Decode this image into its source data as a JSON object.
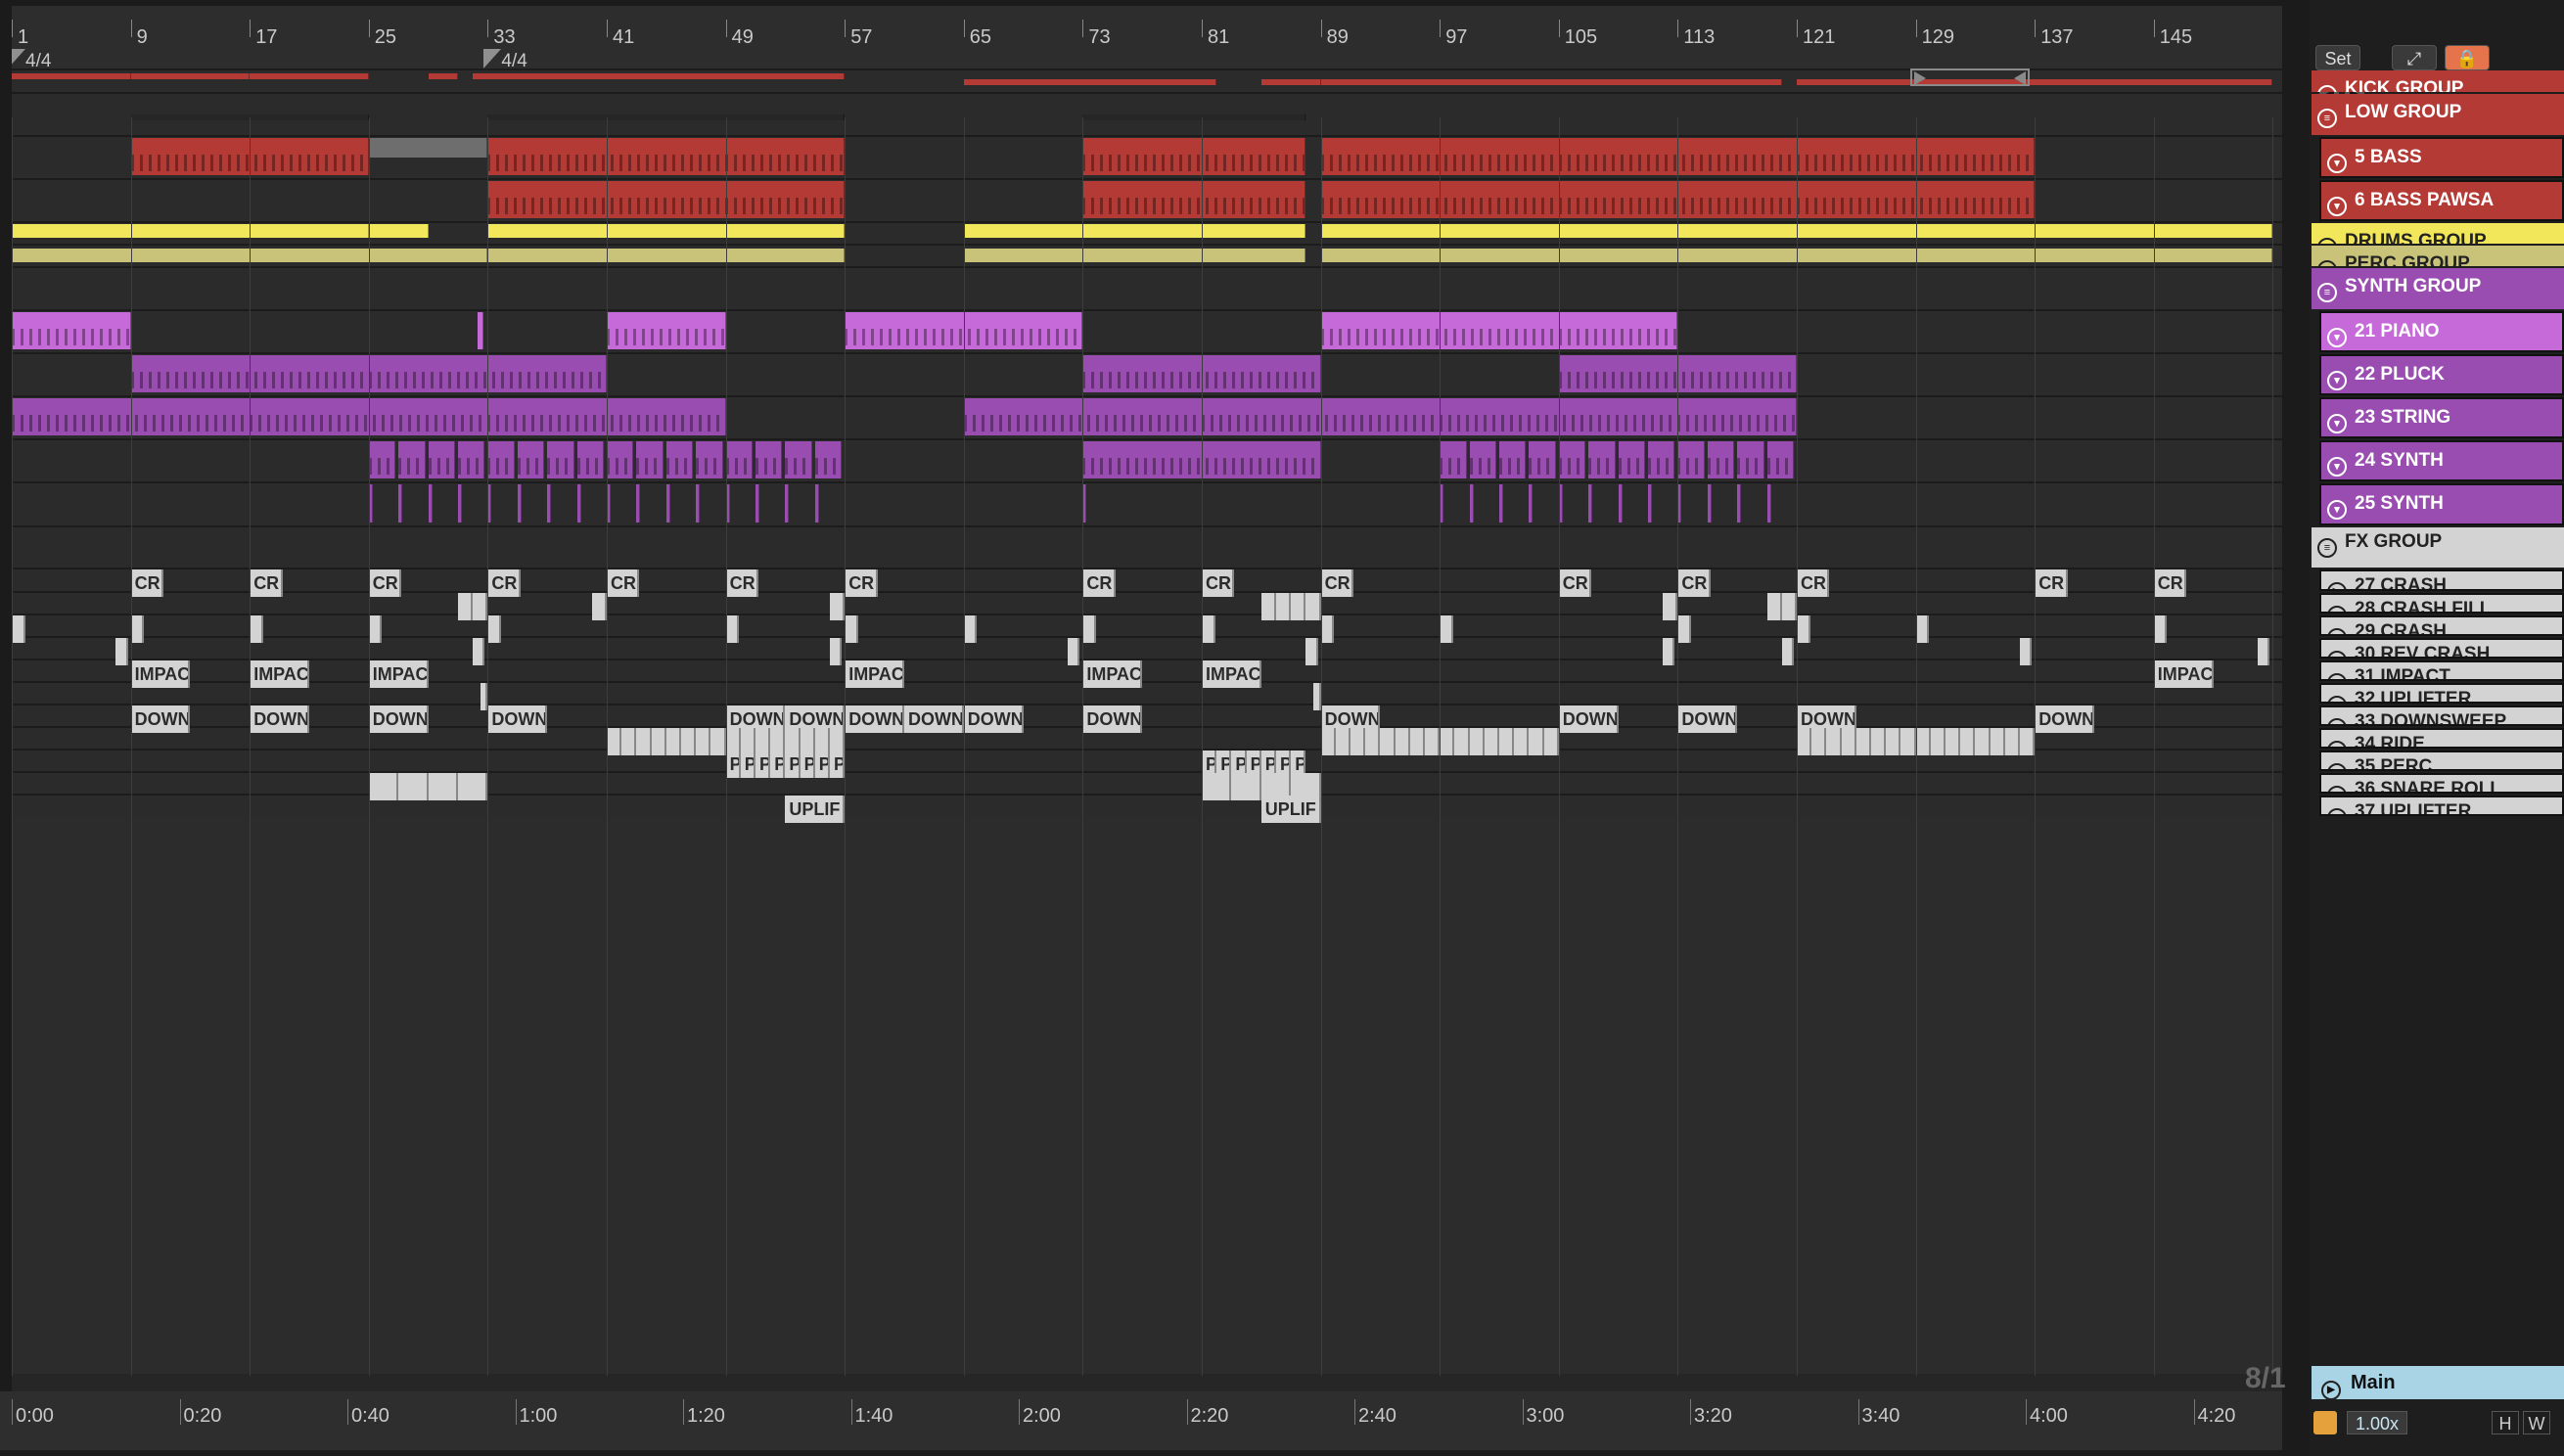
{
  "ruler": {
    "bars": [
      "1",
      "9",
      "17",
      "25",
      "33",
      "41",
      "49",
      "57",
      "65",
      "73",
      "81",
      "89",
      "97",
      "105",
      "113",
      "121",
      "129",
      "137",
      "145"
    ],
    "time_signatures": [
      "4/4",
      "4/4"
    ]
  },
  "controls": {
    "set_label": "Set",
    "expand_icon": "expand-icon",
    "lock_icon": "lock-icon",
    "nav_left": "arrow-left-icon",
    "nav_right": "arrow-right-icon"
  },
  "colors": {
    "red": "#b43a35",
    "yellow": "#f2e65b",
    "olive": "#c9c37a",
    "purple": "#9a4db0",
    "pink": "#c56ad8",
    "fx": "#d3d3d3",
    "main": "#a9d4e6"
  },
  "tracks": [
    {
      "name": "KICK GROUP",
      "type": "group"
    },
    {
      "name": "LOW GROUP",
      "type": "group"
    },
    {
      "name": "5 BASS",
      "type": "midi"
    },
    {
      "name": "6 BASS PAWSA",
      "type": "midi"
    },
    {
      "name": "DRUMS GROUP",
      "type": "group"
    },
    {
      "name": "PERC GROUP",
      "type": "group"
    },
    {
      "name": "SYNTH GROUP",
      "type": "group"
    },
    {
      "name": "21 PIANO",
      "type": "midi"
    },
    {
      "name": "22 PLUCK",
      "type": "midi"
    },
    {
      "name": "23 STRING",
      "type": "midi"
    },
    {
      "name": "24 SYNTH",
      "type": "midi"
    },
    {
      "name": "25 SYNTH",
      "type": "midi"
    },
    {
      "name": "FX GROUP",
      "type": "group"
    },
    {
      "name": "27 CRASH",
      "type": "audio"
    },
    {
      "name": "28 CRASH FILL",
      "type": "audio"
    },
    {
      "name": "29 CRASH",
      "type": "audio"
    },
    {
      "name": "30 REV CRASH",
      "type": "audio"
    },
    {
      "name": "31 IMPACT",
      "type": "audio"
    },
    {
      "name": "32 UPLIFTER",
      "type": "audio"
    },
    {
      "name": "33 DOWNSWEEP",
      "type": "audio"
    },
    {
      "name": "34 RIDE",
      "type": "audio"
    },
    {
      "name": "35 PERC",
      "type": "audio"
    },
    {
      "name": "36 SNARE ROLL",
      "type": "audio"
    },
    {
      "name": "37 UPLIFTER",
      "type": "audio"
    }
  ],
  "main_track": "Main",
  "clip_labels": {
    "crash": "CR",
    "impact": "IMPAC",
    "down": "DOWN",
    "uplif": "UPLIF",
    "ride": "",
    "perc": "P"
  },
  "timeline": [
    "0:00",
    "0:20",
    "0:40",
    "1:00",
    "1:20",
    "1:40",
    "2:00",
    "2:20",
    "2:40",
    "3:00",
    "3:20",
    "3:40",
    "4:00",
    "4:20"
  ],
  "zoom_ratio": "8/1",
  "tempo_scale": "1.00x",
  "bottom_buttons": {
    "h": "H",
    "w": "W"
  }
}
